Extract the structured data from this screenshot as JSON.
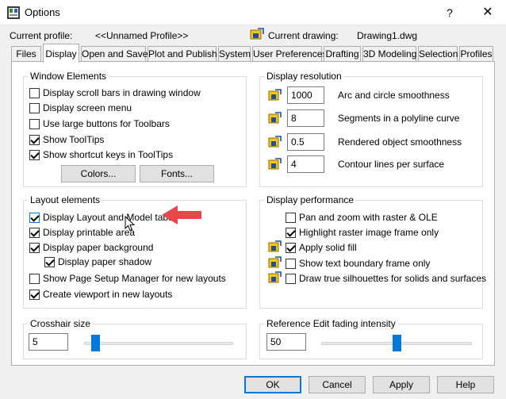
{
  "window": {
    "title": "Options",
    "help": "?",
    "close": "✕"
  },
  "header": {
    "profile_label": "Current profile:",
    "profile_value": "<<Unnamed Profile>>",
    "drawing_label": "Current drawing:",
    "drawing_value": "Drawing1.dwg"
  },
  "tabs": [
    "Files",
    "Display",
    "Open and Save",
    "Plot and Publish",
    "System",
    "User Preferences",
    "Drafting",
    "3D Modeling",
    "Selection",
    "Profiles"
  ],
  "active_tab": "Display",
  "window_elements": {
    "title": "Window Elements",
    "items": [
      {
        "label": "Display scroll bars in drawing window",
        "checked": false
      },
      {
        "label": "Display screen menu",
        "checked": false
      },
      {
        "label": "Use large buttons for Toolbars",
        "checked": false
      },
      {
        "label": "Show ToolTips",
        "checked": true
      },
      {
        "label": "Show shortcut keys in ToolTips",
        "checked": true
      }
    ],
    "colors_button": "Colors...",
    "fonts_button": "Fonts..."
  },
  "display_resolution": {
    "title": "Display resolution",
    "items": [
      {
        "value": "1000",
        "label": "Arc and circle smoothness"
      },
      {
        "value": "8",
        "label": "Segments in a polyline curve"
      },
      {
        "value": "0.5",
        "label": "Rendered object smoothness"
      },
      {
        "value": "4",
        "label": "Contour lines per surface"
      }
    ]
  },
  "layout_elements": {
    "title": "Layout elements",
    "items": [
      {
        "label": "Display Layout and Model tabs",
        "checked": true
      },
      {
        "label": "Display printable area",
        "checked": true
      },
      {
        "label": "Display paper background",
        "checked": true
      },
      {
        "label": "Display paper shadow",
        "checked": true
      },
      {
        "label": "Show Page Setup Manager for new layouts",
        "checked": false
      },
      {
        "label": "Create viewport in new layouts",
        "checked": true
      }
    ]
  },
  "display_performance": {
    "title": "Display performance",
    "items": [
      {
        "label": "Pan and zoom with raster & OLE",
        "checked": false
      },
      {
        "label": "Highlight raster image frame only",
        "checked": true
      },
      {
        "label": "Apply solid fill",
        "checked": true
      },
      {
        "label": "Show text boundary frame only",
        "checked": false
      },
      {
        "label": "Draw true silhouettes for solids and surfaces",
        "checked": false
      }
    ]
  },
  "crosshair": {
    "title": "Crosshair size",
    "value": "5",
    "slider_fraction": 0.05
  },
  "refedit": {
    "title": "Reference Edit fading intensity",
    "value": "50",
    "slider_fraction": 0.5
  },
  "footer": {
    "ok": "OK",
    "cancel": "Cancel",
    "apply": "Apply",
    "help": "Help"
  },
  "colors": {
    "accent": "#0078d7",
    "annotation_arrow": "#e8484a",
    "icon_yellow": "#f5c518",
    "icon_blue": "#1f4e9c"
  }
}
